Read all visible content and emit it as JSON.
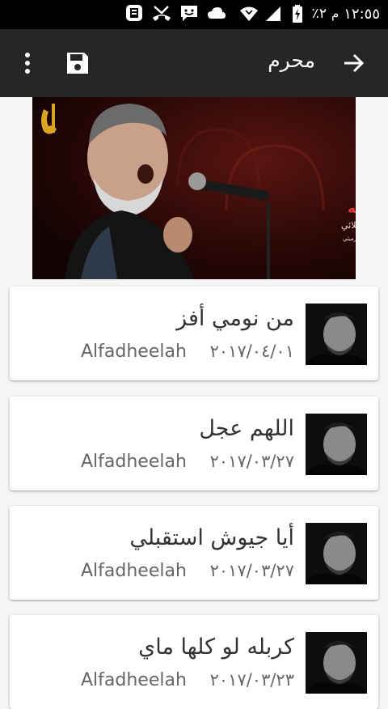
{
  "status_bar": {
    "time": "١٢:٥٥",
    "ampm": "م",
    "battery": "٪٢",
    "icons": [
      "recorder-icon",
      "missed-call-icon",
      "message-icon",
      "cloud-icon",
      "wifi-icon",
      "signal-icon",
      "battery-charging-icon"
    ]
  },
  "toolbar": {
    "title": "محرم",
    "icons": [
      "more-vert-icon",
      "save-icon",
      "arrow-forward-icon"
    ]
  },
  "banner": {
    "line1": "عاشور جل جلاله",
    "line2": "باسم الكربلائي",
    "line3": "كلمات السيد سعيد الصافي الرميثي"
  },
  "tracks": [
    {
      "title": "من نومي أفز",
      "date": "٢٠١٧/٠٤/٠١",
      "author": "Alfadheelah"
    },
    {
      "title": "اللهم عجل",
      "date": "٢٠١٧/٠٣/٢٧",
      "author": "Alfadheelah"
    },
    {
      "title": "أيا جيوش استقبلي",
      "date": "٢٠١٧/٠٣/٢٧",
      "author": "Alfadheelah"
    },
    {
      "title": "كربله لو كلها ماي",
      "date": "٢٠١٧/٠٣/٢٣",
      "author": "Alfadheelah"
    }
  ],
  "colors": {
    "toolbar": "#262626",
    "status_bar": "#000000",
    "background": "#f5f5f5",
    "card": "#ffffff",
    "banner_text": "#e53935"
  }
}
